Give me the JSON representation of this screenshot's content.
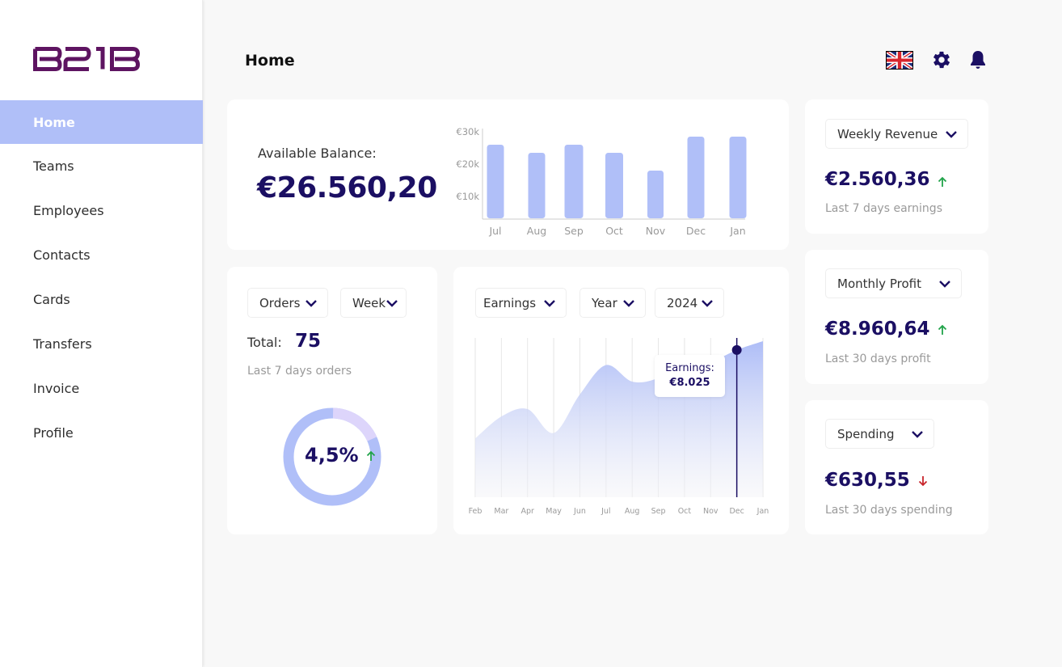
{
  "brand": {
    "logo_text": "BE1B",
    "logo_color": "#5e1461"
  },
  "sidebar": {
    "items": [
      {
        "label": "Home",
        "active": true
      },
      {
        "label": "Teams",
        "active": false
      },
      {
        "label": "Employees",
        "active": false
      },
      {
        "label": "Contacts",
        "active": false
      },
      {
        "label": "Cards",
        "active": false
      },
      {
        "label": "Transfers",
        "active": false
      },
      {
        "label": "Invoice",
        "active": false
      },
      {
        "label": "Profile",
        "active": false
      }
    ]
  },
  "header": {
    "title": "Home",
    "icons": [
      "uk-flag-icon",
      "gear-icon",
      "bell-icon"
    ]
  },
  "colors": {
    "accent": "#b0bff8",
    "primary_text": "#1b0f63",
    "up": "#21a34a",
    "down": "#c8242b",
    "donut_secondary": "#ddd5fb"
  },
  "balance": {
    "label": "Available Balance:",
    "value": "€26.560,20"
  },
  "orders": {
    "filter_metric": "Orders",
    "filter_period": "Week",
    "total_label": "Total:",
    "total_value": "75",
    "subtitle": "Last 7 days orders",
    "percent": "4,5%",
    "trend": "up",
    "donut_fraction": 0.18
  },
  "earnings": {
    "filter_metric": "Earnings",
    "filter_period": "Year",
    "filter_year": "2024",
    "tooltip_label": "Earnings:",
    "tooltip_value": "€8.025",
    "highlight_month": "Dec"
  },
  "stats": [
    {
      "selector": "Weekly Revenue",
      "value": "€2.560,36",
      "trend": "up",
      "subtitle": "Last 7 days earnings"
    },
    {
      "selector": "Monthly Profit",
      "value": "€8.960,64",
      "trend": "up",
      "subtitle": "Last 30 days profit"
    },
    {
      "selector": "Spending",
      "value": "€630,55",
      "trend": "down",
      "subtitle": "Last 30 days spending"
    }
  ],
  "chart_data": [
    {
      "type": "bar",
      "title": "",
      "categories": [
        "Jul",
        "Aug",
        "Sep",
        "Oct",
        "Nov",
        "Dec",
        "Jan"
      ],
      "values": [
        26000,
        23500,
        26000,
        23500,
        18000,
        28500,
        28500
      ],
      "yticks": [
        10000,
        20000,
        30000
      ],
      "ytick_labels": [
        "€10k",
        "€20k",
        "€30k"
      ],
      "ylim": [
        3000,
        30000
      ],
      "xlabel": "",
      "ylabel": "",
      "grid": false
    },
    {
      "type": "area",
      "title": "Earnings",
      "categories": [
        "Feb",
        "Mar",
        "Apr",
        "May",
        "Jun",
        "Jul",
        "Aug",
        "Sep",
        "Oct",
        "Nov",
        "Dec",
        "Jan"
      ],
      "values": [
        3200,
        4400,
        4800,
        3500,
        5600,
        7200,
        6300,
        6500,
        7400,
        7400,
        8025,
        8500
      ],
      "ylim": [
        0,
        10000
      ],
      "highlight": {
        "category": "Dec",
        "value": 8025,
        "label": "Earnings:",
        "value_label": "€8.025"
      },
      "xlabel": "",
      "ylabel": "",
      "grid": "vertical"
    }
  ]
}
